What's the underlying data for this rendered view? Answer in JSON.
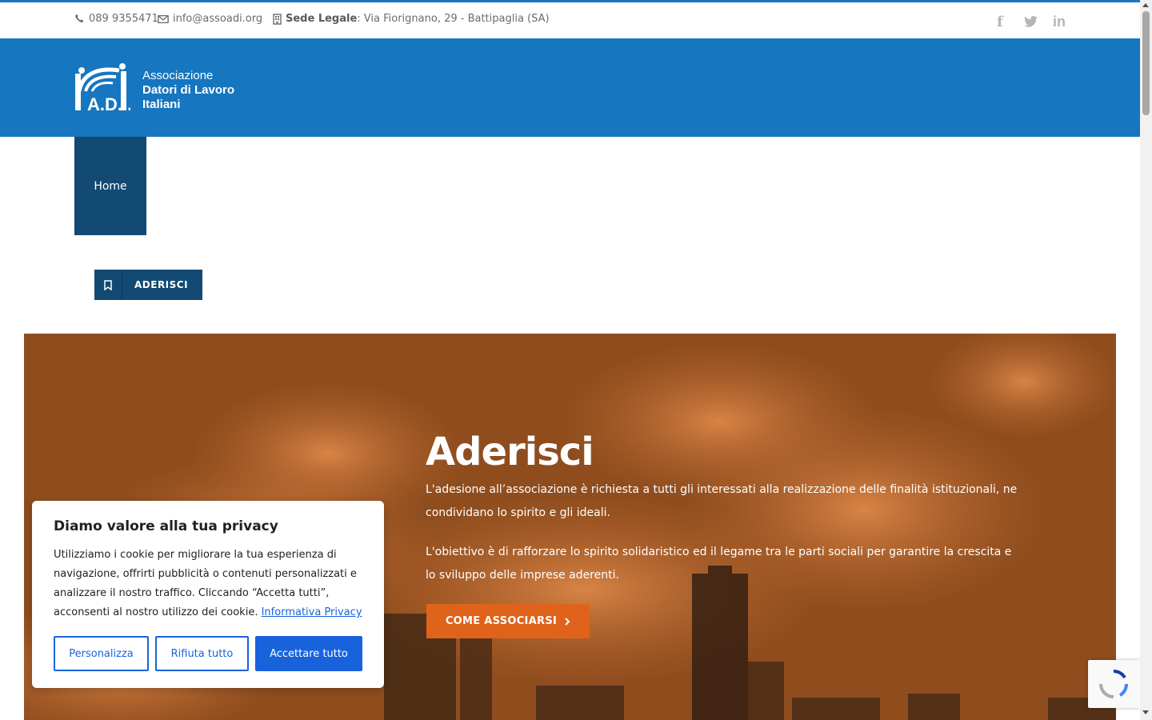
{
  "topbar": {
    "phone": "089 9355471",
    "email": "info@assoadi.org",
    "address_label": "Sede Legale",
    "address": ": Via Fiorignano, 29 - Battipaglia (SA)",
    "social": [
      "facebook-icon",
      "twitter-icon",
      "linkedin-icon"
    ]
  },
  "logo": {
    "mark": "A.D.I.",
    "line1": "Associazione",
    "line2": "Datori di Lavoro",
    "line3": "Italiani"
  },
  "nav": {
    "home": "Home"
  },
  "aderisci_button": "ADERISCI",
  "hero": {
    "title": "Aderisci",
    "p1": "L'adesione all’associazione è richiesta a tutti gli interessati alla realizzazione delle finalità istituzionali, ne condividano lo spirito e gli ideali.",
    "p2": "L'obiettivo è di rafforzare lo spirito solidaristico ed il legame tra le parti sociali per garantire la crescita e lo sviluppo delle imprese aderenti.",
    "cta": "COME ASSOCIARSI"
  },
  "cookie": {
    "title": "Diamo valore alla tua privacy",
    "text": "Utilizziamo i cookie per migliorare la tua esperienza di navigazione, offrirti pubblicità o contenuti personalizzati e analizzare il nostro traffico. Cliccando “Accetta tutti”, acconsenti al nostro utilizzo dei cookie.",
    "link": "Informativa Privacy",
    "btn_customize": "Personalizza",
    "btn_reject": "Rifiuta tutto",
    "btn_accept": "Accettare tutto"
  },
  "colors": {
    "brand_blue": "#1676bf",
    "dark_blue": "#124a73",
    "orange": "#e0631b",
    "cookie_blue": "#1863dc"
  }
}
